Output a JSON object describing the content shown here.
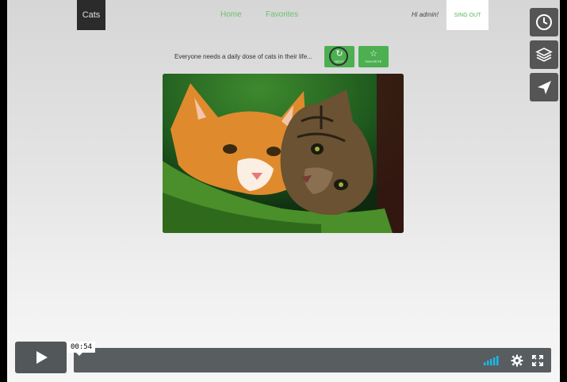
{
  "header": {
    "brand": "Cats",
    "nav": [
      {
        "label": "Home"
      },
      {
        "label": "Favorites"
      }
    ],
    "greeting": "Hi admin!",
    "signout_label": "SING OUT"
  },
  "main": {
    "tagline": "Everyone needs a daily dose of cats in their life...",
    "refresh_label": "NEXT",
    "favorite_label": "FAVORITE"
  },
  "player": {
    "timestamp": "00:54",
    "colors": {
      "accent": "#4caf50",
      "bar": "#585e60",
      "volume": "#1ab7ea"
    }
  },
  "icons": {
    "side": [
      "clock-icon",
      "layers-icon",
      "send-icon"
    ],
    "controls": [
      "play-icon",
      "volume-icon",
      "gear-icon",
      "fullscreen-icon"
    ]
  }
}
